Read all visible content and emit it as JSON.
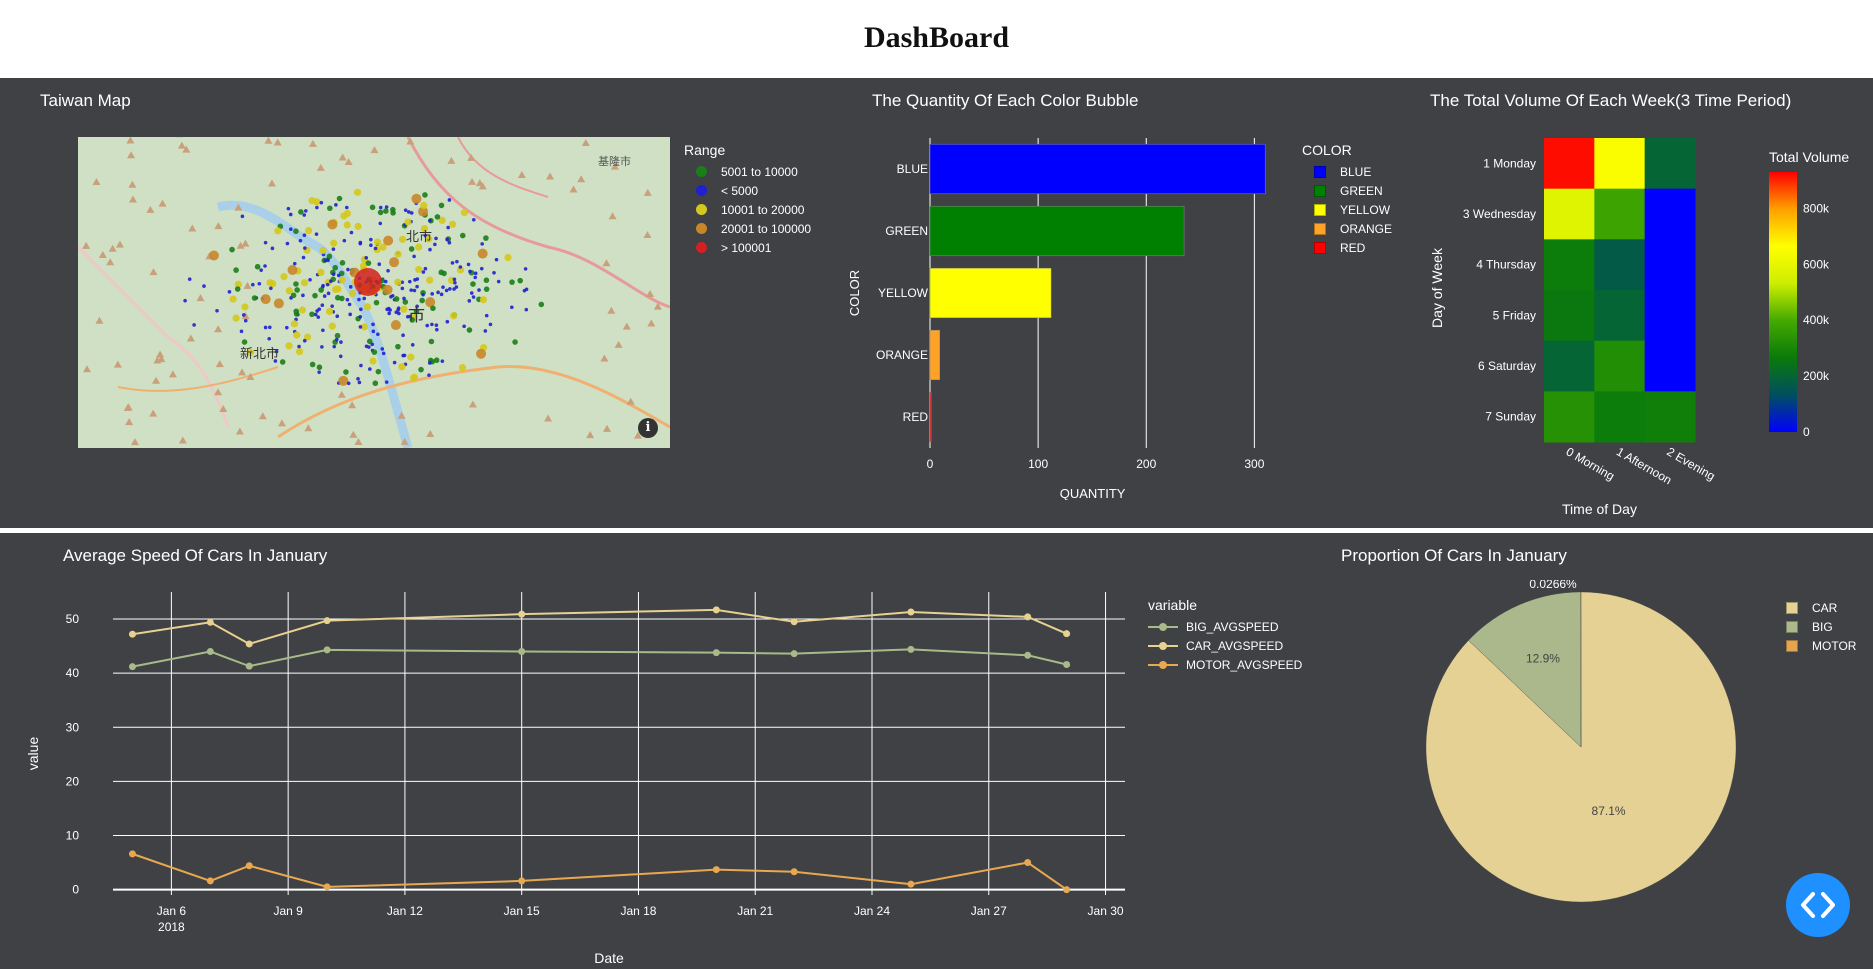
{
  "page_title": "DashBoard",
  "map": {
    "title": "Taiwan Map",
    "legend_title": "Range",
    "legend": [
      {
        "label": "5001 to 10000",
        "color": "#1a7f1a"
      },
      {
        "label": "< 5000",
        "color": "#2020d0"
      },
      {
        "label": "10001 to 20000",
        "color": "#d4c81c"
      },
      {
        "label": "20001 to 100000",
        "color": "#c8862a"
      },
      {
        "label": "> 100001",
        "color": "#d42020"
      }
    ],
    "place_labels": [
      "新北市",
      "基隆市",
      "市",
      "北市"
    ],
    "info_icon": "info-icon"
  },
  "chart_data": [
    {
      "type": "bar",
      "title": "The Quantity Of Each Color Bubble",
      "orientation": "horizontal",
      "categories": [
        "BLUE",
        "GREEN",
        "YELLOW",
        "ORANGE",
        "RED"
      ],
      "values": [
        310,
        235,
        112,
        9,
        1
      ],
      "colors": [
        "#0000ff",
        "#008000",
        "#ffff00",
        "#ffa228",
        "#ff0000"
      ],
      "xlabel": "QUANTITY",
      "ylabel": "COLOR",
      "xlim": [
        0,
        320
      ],
      "xticks": [
        0,
        100,
        200,
        300
      ],
      "legend_title": "COLOR",
      "legend": [
        "BLUE",
        "GREEN",
        "YELLOW",
        "ORANGE",
        "RED"
      ]
    },
    {
      "type": "heatmap",
      "title": "The Total Volume Of Each Week(3 Time Period)",
      "x": [
        "0 Morning",
        "1 Afternoon",
        "2 Evening"
      ],
      "y": [
        "1 Monday",
        "3 Wednesday",
        "4 Thursday",
        "5 Friday",
        "6 Saturday",
        "7 Sunday"
      ],
      "z": [
        [
          920000,
          650000,
          200000
        ],
        [
          580000,
          380000,
          0
        ],
        [
          270000,
          170000,
          0
        ],
        [
          260000,
          200000,
          0
        ],
        [
          200000,
          320000,
          0
        ],
        [
          330000,
          270000,
          280000
        ]
      ],
      "xlabel": "Time of Day",
      "ylabel": "Day of Week",
      "colorbar_title": "Total Volume",
      "colorbar_ticks": [
        "800k",
        "600k",
        "400k",
        "200k",
        "0"
      ],
      "zrange": [
        0,
        930000
      ],
      "colorscale": [
        "#0000ff",
        "#004f5f",
        "#0a7a0a",
        "#44aa00",
        "#ccee00",
        "#ffff00",
        "#ffa000",
        "#ff0000"
      ]
    },
    {
      "type": "line",
      "title": "Average Speed Of Cars In January",
      "x_dates": [
        "2018-01-05",
        "2018-01-07",
        "2018-01-08",
        "2018-01-10",
        "2018-01-15",
        "2018-01-20",
        "2018-01-22",
        "2018-01-25",
        "2018-01-28",
        "2018-01-29"
      ],
      "series": [
        {
          "name": "BIG_AVGSPEED",
          "color": "#a8ba8a",
          "values": [
            41.2,
            44.0,
            41.3,
            44.3,
            44.0,
            43.8,
            43.6,
            44.4,
            43.3,
            41.6
          ]
        },
        {
          "name": "CAR_AVGSPEED",
          "color": "#e8d090",
          "values": [
            47.2,
            49.4,
            45.4,
            49.7,
            50.9,
            51.7,
            49.5,
            51.3,
            50.4,
            47.3
          ]
        },
        {
          "name": "MOTOR_AVGSPEED",
          "color": "#e8a850",
          "values": [
            6.6,
            1.6,
            4.4,
            0.5,
            1.6,
            3.7,
            3.3,
            1.0,
            5.0,
            0.0
          ]
        }
      ],
      "legend_title": "variable",
      "xlabel": "Date",
      "ylabel": "value",
      "ylim": [
        -1,
        55
      ],
      "yticks": [
        0,
        10,
        20,
        30,
        40,
        50
      ],
      "xticks": [
        "Jan 6",
        "Jan 9",
        "Jan 12",
        "Jan 15",
        "Jan 18",
        "Jan 21",
        "Jan 24",
        "Jan 27",
        "Jan 30"
      ],
      "xtick_year": "2018",
      "xlim": [
        "2018-01-04T12:00",
        "2018-01-30T12:00"
      ]
    },
    {
      "type": "pie",
      "title": "Proportion Of Cars In January",
      "labels": [
        "CAR",
        "BIG",
        "MOTOR"
      ],
      "values": [
        87.1,
        12.9,
        0.0266
      ],
      "text": [
        "87.1%",
        "12.9%",
        "0.0266%"
      ],
      "colors": [
        "#e5d193",
        "#abb88c",
        "#e5a550"
      ],
      "legend": [
        "CAR",
        "BIG",
        "MOTOR"
      ]
    }
  ]
}
